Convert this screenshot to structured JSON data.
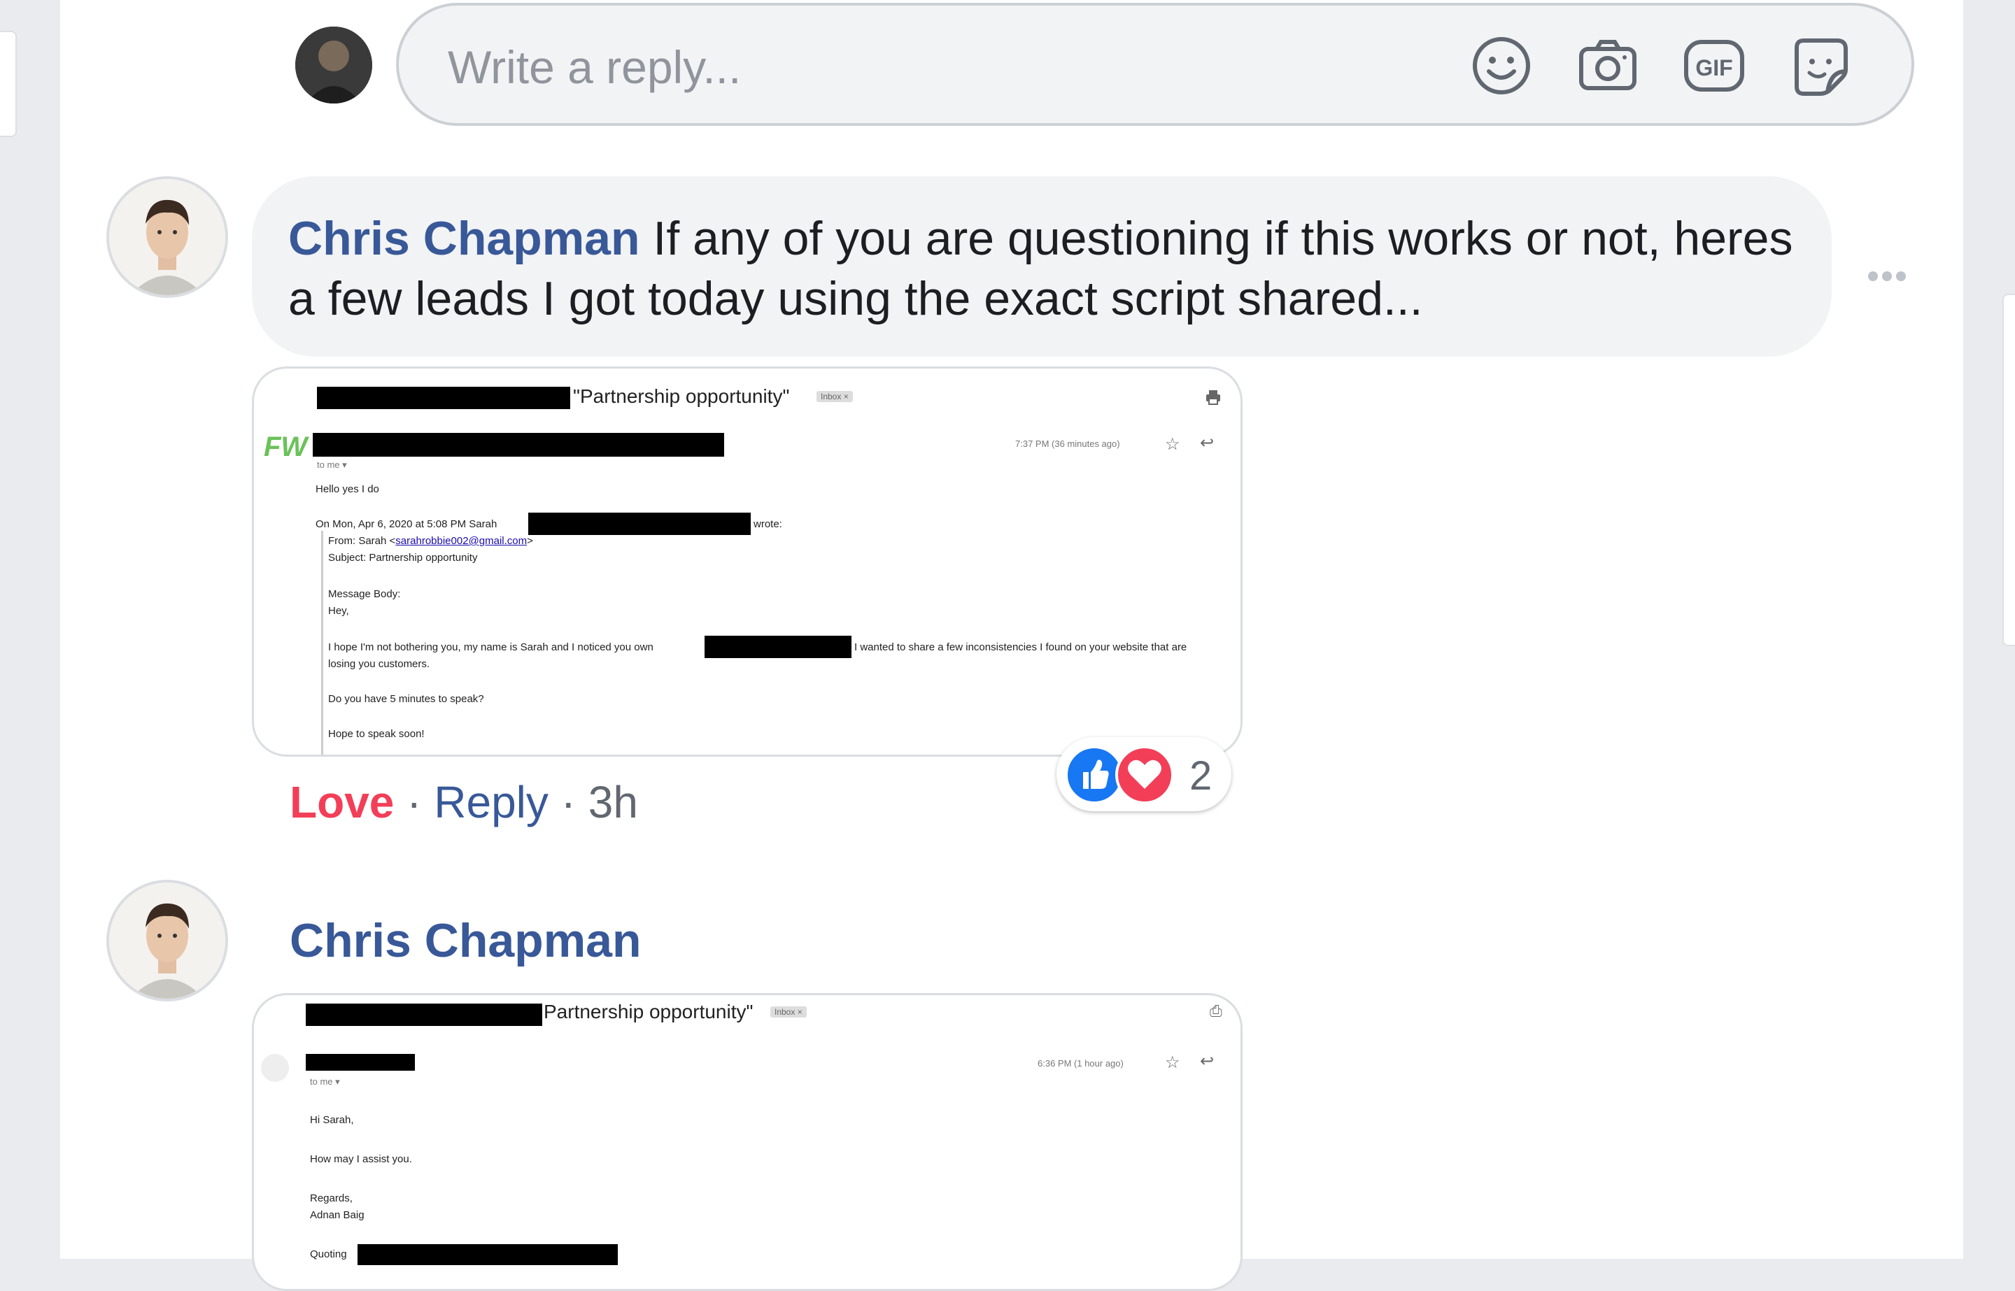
{
  "reply_box": {
    "placeholder": "Write a reply...",
    "icons": [
      "emoji-icon",
      "camera-icon",
      "gif-icon",
      "sticker-icon"
    ],
    "gif_label": "GIF"
  },
  "comments": [
    {
      "author": "Chris Chapman",
      "text": " If any of you are questioning if this works or not, heres a few leads I got today using the exact script shared...",
      "attachment": {
        "subject": "\"Partnership opportunity\"",
        "badge": "Inbox ×",
        "logo": "FW",
        "time": "7:37 PM (36 minutes ago)",
        "to": "to me ▾",
        "line1": "Hello yes I do",
        "line2": "On Mon, Apr 6, 2020 at 5:08 PM Sarah",
        "line2_end": "wrote:",
        "from_prefix": "From: Sarah <",
        "from_email": "sarahrobbie002@gmail.com",
        "from_suffix": ">",
        "subject_line": "Subject: Partnership opportunity",
        "body_label": "Message Body:",
        "hey": "Hey,",
        "p1a": "I hope I'm not bothering you, my name is Sarah and I noticed you own",
        "p1b": "I wanted to share a few inconsistencies I found on your website that are",
        "p1c": "losing you customers.",
        "p2": "Do you have 5 minutes to speak?",
        "p3": "Hope to speak soon!"
      },
      "actions": {
        "love": "Love",
        "sep1": " · ",
        "reply": "Reply",
        "sep2": " · ",
        "time": "3h"
      },
      "reactions": {
        "count": "2",
        "types": [
          "like",
          "love"
        ]
      }
    },
    {
      "author": "Chris Chapman",
      "attachment": {
        "subject": "Partnership opportunity\"",
        "badge": "Inbox ×",
        "time": "6:36 PM (1 hour ago)",
        "to": "to me ▾",
        "greeting": "Hi Sarah,",
        "body": "How may I assist you.",
        "regards": "Regards,",
        "name": "Adnan Baig",
        "quoting": "Quoting"
      }
    }
  ],
  "colors": {
    "link_blue": "#385898",
    "love_red": "#f33e58",
    "like_blue": "#1877f2",
    "bubble_bg": "#f2f3f5",
    "page_bg": "#e9ebee"
  }
}
